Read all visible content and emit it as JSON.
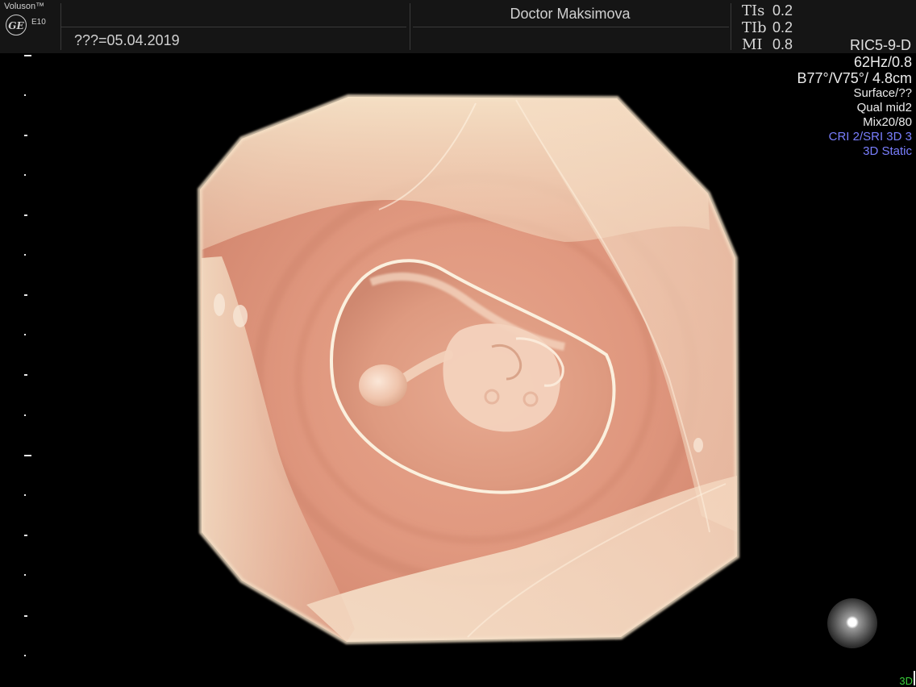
{
  "header": {
    "brand": "Voluson™",
    "model": "E10",
    "date": "???=05.04.2019",
    "doctor": "Doctor Maksimova",
    "indices": [
      {
        "label": "TIs",
        "value": "0.2"
      },
      {
        "label": "TIb",
        "value": "0.2"
      },
      {
        "label": "MI",
        "value": "0.8"
      }
    ],
    "probe": "RIC5-9-D"
  },
  "info": {
    "frame_rate": "62Hz/0.8",
    "angles": "B77°/V75°/ 4.8cm",
    "render_mode": "Surface/??",
    "quality": "Qual mid2",
    "mix": "Mix20/80",
    "cri": "CRI 2/SRI 3D 3",
    "acquisition": "3D Static"
  },
  "footer": {
    "mode": "3D"
  },
  "colors": {
    "tissue": "#e0987f",
    "membrane": "#efdcc0",
    "highlight_blue": "#7a7fff",
    "mode_green": "#39d13b"
  }
}
